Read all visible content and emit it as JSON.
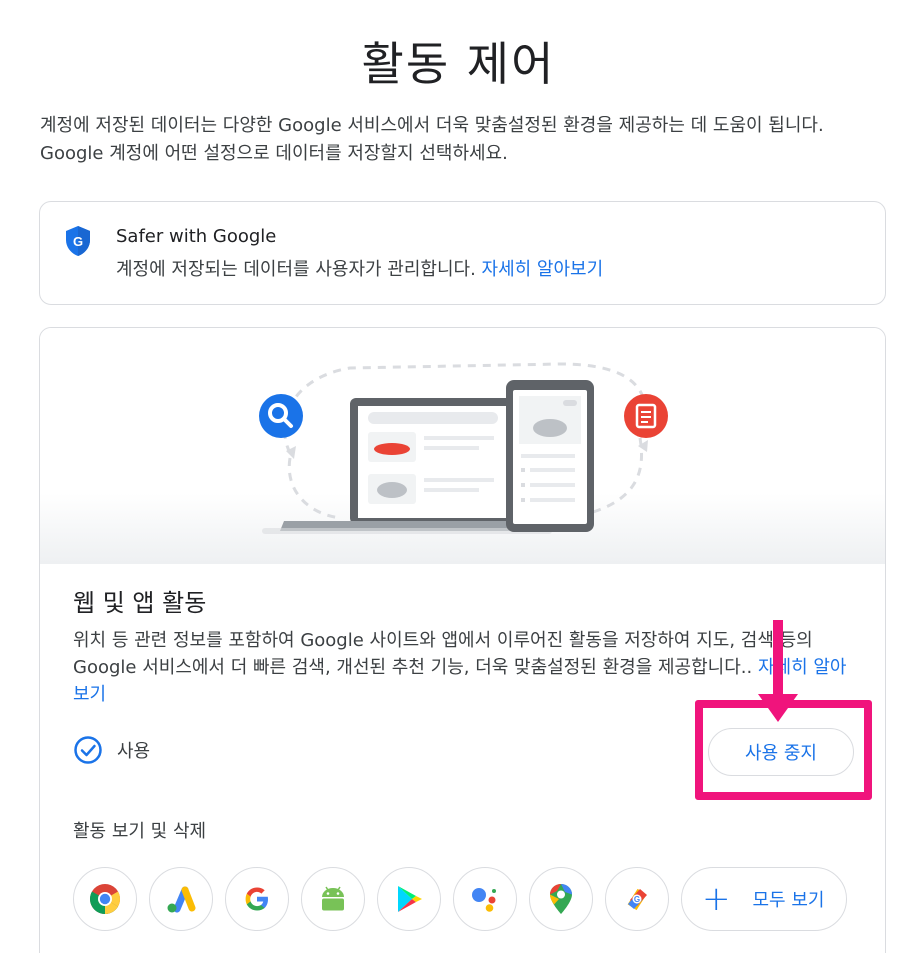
{
  "page": {
    "title": "활동 제어",
    "intro": "계정에 저장된 데이터는 다양한 Google 서비스에서 더욱 맞춤설정된 환경을 제공하는 데 도움이 됩니다. Google 계정에 어떤 설정으로 데이터를 저장할지 선택하세요."
  },
  "safer": {
    "title": "Safer with Google",
    "desc": "계정에 저장되는 데이터를 사용자가 관리합니다. ",
    "link": "자세히 알아보기",
    "icon": "shield-g-icon"
  },
  "activity": {
    "title": "웹 및 앱 활동",
    "desc": "위치 등 관련 정보를 포함하여 Google 사이트와 앱에서 이루어진 활동을 저장하여 지도, 검색 등의 Google 서비스에서 더 빠른 검색, 개선된 추천 기능, 더욱 맞춤설정된 환경을 제공합니다.. ",
    "link": "자세히 알아보기",
    "status_label": "사용",
    "pause_label": "사용 중지",
    "view_delete_label": "활동 보기 및 삭제",
    "view_all_label": "모두 보기",
    "apps": [
      "chrome-icon",
      "google-ads-icon",
      "google-icon",
      "android-icon",
      "google-play-icon",
      "google-assistant-icon",
      "google-maps-icon",
      "google-pay-icon"
    ]
  },
  "colors": {
    "accent": "#1a73e8",
    "annotation": "#f0147c"
  }
}
